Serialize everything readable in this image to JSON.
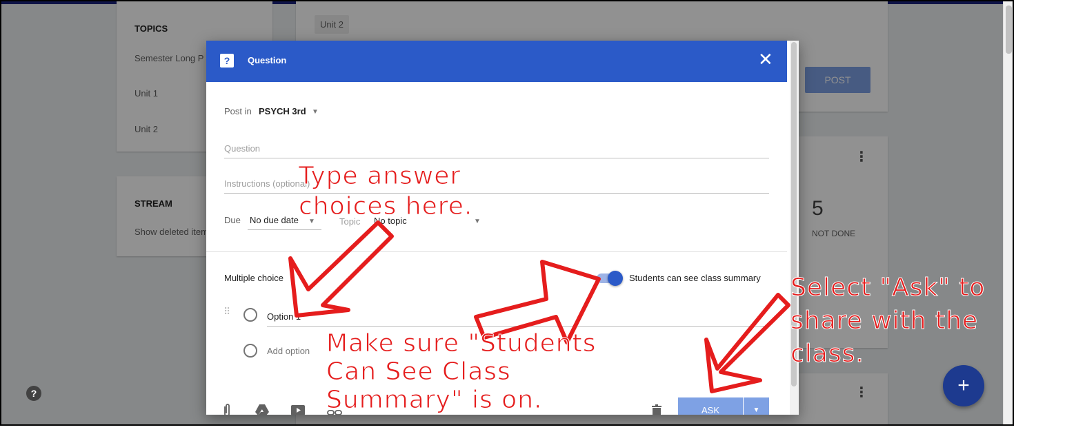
{
  "sidebar": {
    "topics_heading": "TOPICS",
    "topics": [
      "Semester Long P",
      "Unit 1",
      "Unit 2"
    ],
    "stream_heading": "STREAM",
    "stream_link": "Show deleted item"
  },
  "main": {
    "unit_chip": "Unit 2",
    "post_button": "POST",
    "stat_number": "5",
    "stat_label": "NOT DONE",
    "kebab": "⋮"
  },
  "help_icon": "?",
  "fab_icon": "+",
  "dialog": {
    "header_icon": "question-icon",
    "title": "Question",
    "close_icon": "✕",
    "post_in_label": "Post in",
    "post_in_value": "PSYCH 3rd",
    "question_placeholder": "Question",
    "instructions_placeholder": "Instructions (optional)",
    "due_label": "Due",
    "due_value": "No due date",
    "topic_label": "Topic",
    "topic_value": "No topic",
    "type_label": "Multiple choice",
    "toggle_on": true,
    "toggle_label": "Students can see class summary",
    "option1": "Option 1",
    "add_option": "Add option",
    "ask_button": "ASK",
    "ask_menu_icon": "▼",
    "header_color": "#2b5ac8"
  },
  "annotations": {
    "type_answers": [
      "Type answer",
      "choices here."
    ],
    "make_sure": [
      "Make sure \"Students",
      "Can See Class",
      "Summary\" is on."
    ],
    "select_ask": [
      "Select \"Ask\" to",
      "share with the",
      "class."
    ],
    "color": "#e51d1d"
  }
}
